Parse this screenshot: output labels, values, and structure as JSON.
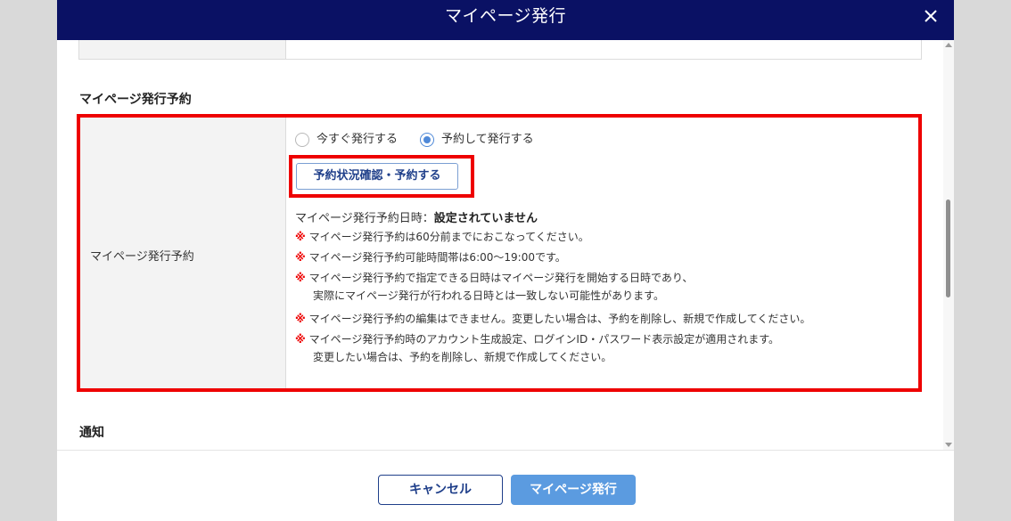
{
  "modal": {
    "title": "マイページ発行",
    "close_icon": "close-icon"
  },
  "reservation_section": {
    "heading": "マイページ発行予約",
    "row_label": "マイページ発行予約",
    "radio_options": [
      {
        "label": "今すぐ発行する",
        "selected": false
      },
      {
        "label": "予約して発行する",
        "selected": true
      }
    ],
    "reserve_button_label": "予約状況確認・予約する",
    "status_label": "マイページ発行予約日時：",
    "status_value": "設定されていません",
    "note_mark": "※",
    "notes": [
      {
        "line1": "マイページ発行予約は60分前までにおこなってください。"
      },
      {
        "line1": "マイページ発行予約可能時間帯は6:00～19:00です。"
      },
      {
        "line1": "マイページ発行予約で指定できる日時はマイページ発行を開始する日時であり、",
        "line2": "実際にマイページ発行が行われる日時とは一致しない可能性があります。"
      },
      {
        "line1": "マイページ発行予約の編集はできません。変更したい場合は、予約を削除し、新規で作成してください。"
      },
      {
        "line1": "マイページ発行予約時のアカウント生成設定、ログインID・パスワード表示設定が適用されます。",
        "line2": "変更したい場合は、予約を削除し、新規で作成してください。"
      }
    ]
  },
  "notification_section": {
    "heading": "通知"
  },
  "footer": {
    "cancel_label": "キャンセル",
    "issue_label": "マイページ発行"
  },
  "colors": {
    "header_bg": "#0a1164",
    "highlight": "#ee0000",
    "primary_button": "#5b9be0",
    "radio_selected": "#4f89d8"
  }
}
